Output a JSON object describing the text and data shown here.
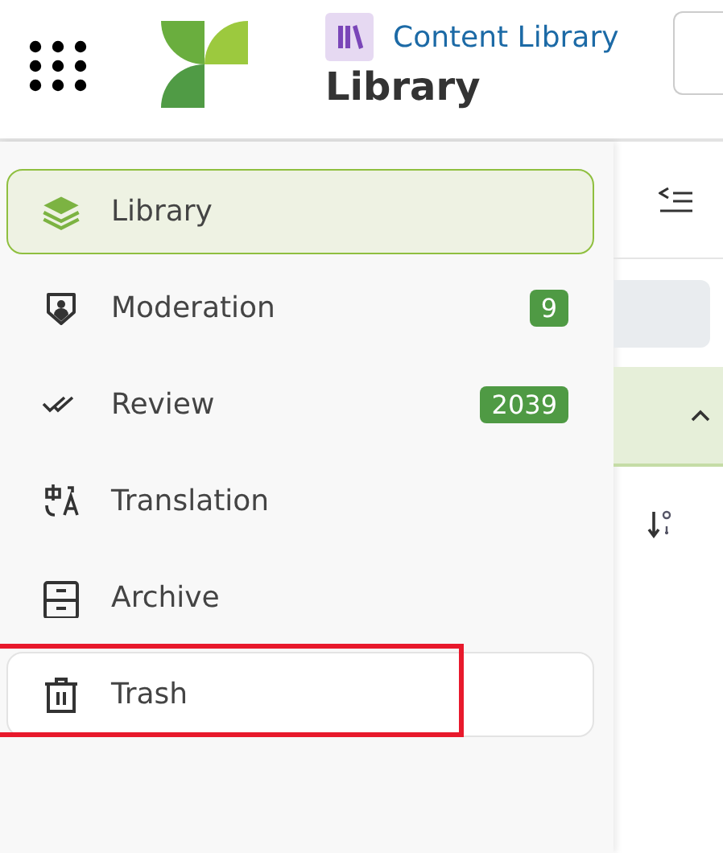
{
  "header": {
    "app_name": "Content Library",
    "page_title": "Library"
  },
  "sidebar": {
    "items": [
      {
        "kind": "library",
        "label": "Library",
        "selected": true,
        "hovered": false
      },
      {
        "kind": "moderation",
        "label": "Moderation",
        "badge": "9",
        "selected": false,
        "hovered": false
      },
      {
        "kind": "review",
        "label": "Review",
        "badge": "2039",
        "selected": false,
        "hovered": false
      },
      {
        "kind": "translation",
        "label": "Translation",
        "selected": false,
        "hovered": false
      },
      {
        "kind": "archive",
        "label": "Archive",
        "selected": false,
        "hovered": false
      },
      {
        "kind": "trash",
        "label": "Trash",
        "selected": false,
        "hovered": true,
        "outlined": true
      }
    ]
  }
}
